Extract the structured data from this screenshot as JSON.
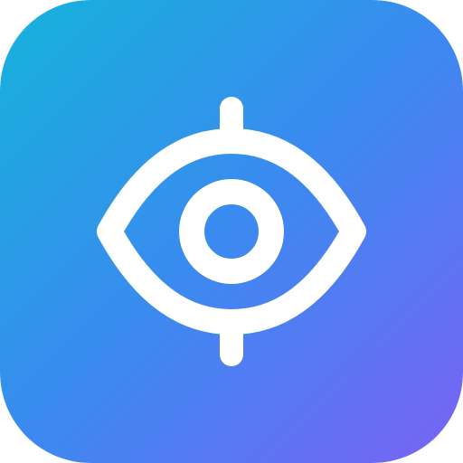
{
  "icon": {
    "glyph": "eye-icon",
    "style": "rounded-square app icon with white line-art eye and vertical tick marks",
    "colors": {
      "gradient_start": "#14B3DA",
      "gradient_mid": "#3B8AF0",
      "gradient_end": "#7A62F5",
      "glyph": "#FFFFFF"
    }
  }
}
